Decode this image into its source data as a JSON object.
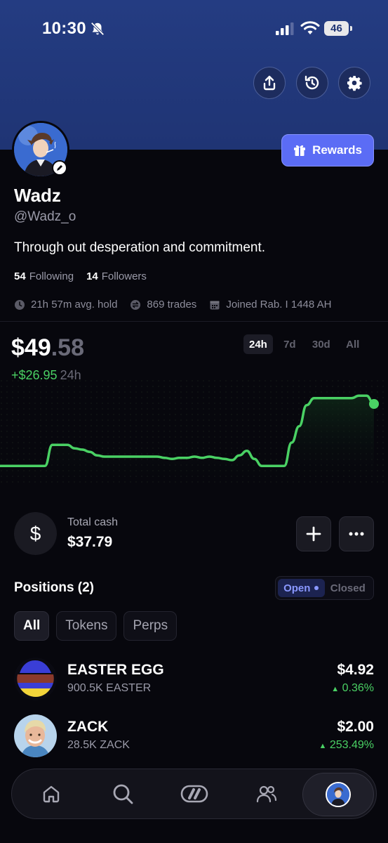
{
  "status_bar": {
    "time": "10:30",
    "battery": "46"
  },
  "header": {
    "share_icon": "share-icon",
    "history_icon": "history-icon",
    "settings_icon": "gear-icon",
    "rewards_label": "Rewards"
  },
  "profile": {
    "name": "Wadz",
    "handle": "@Wadz_o",
    "bio": "Through out desperation and commitment.",
    "following_count": "54",
    "following_label": "Following",
    "followers_count": "14",
    "followers_label": "Followers",
    "avg_hold": "21h 57m avg. hold",
    "trades": "869 trades",
    "joined": "Joined Rab. I 1448 AH"
  },
  "portfolio": {
    "balance_dollars": "$49",
    "balance_cents": ".58",
    "change_value": "+$26.95",
    "change_period": "24h",
    "ranges": [
      "24h",
      "7d",
      "30d",
      "All"
    ],
    "active_range": "24h",
    "accent_color": "#4ad164"
  },
  "chart_data": {
    "type": "line",
    "title": "",
    "xlabel": "",
    "ylabel": "",
    "x": [
      0,
      1,
      2,
      3,
      4,
      5,
      6,
      7,
      8,
      9,
      10,
      11,
      12,
      13,
      14,
      15,
      16,
      17,
      18,
      19,
      20,
      21,
      22,
      23,
      24,
      25,
      26,
      27,
      28,
      29,
      30,
      31,
      32,
      33,
      34,
      35,
      36,
      37,
      38,
      39,
      40,
      41,
      42,
      43,
      44,
      45,
      46,
      47,
      48,
      49,
      50
    ],
    "values": [
      22.6,
      22.6,
      22.6,
      22.6,
      22.6,
      22.6,
      22.6,
      24.4,
      24.4,
      24.4,
      24.1,
      24.0,
      23.8,
      23.5,
      23.4,
      23.4,
      23.4,
      23.4,
      23.4,
      23.4,
      23.4,
      23.4,
      23.3,
      23.2,
      23.3,
      23.3,
      23.4,
      23.3,
      23.4,
      23.3,
      23.2,
      23.1,
      23.5,
      23.9,
      23.2,
      22.6,
      22.6,
      22.6,
      22.6,
      24.6,
      26.0,
      27.8,
      28.4,
      28.4,
      28.4,
      28.4,
      28.4,
      28.4,
      28.6,
      28.6,
      27.9
    ],
    "ylim": [
      21.0,
      30.0
    ],
    "grid": false,
    "legend": "none"
  },
  "cash": {
    "icon": "dollar-icon",
    "label": "Total cash",
    "value": "$37.79"
  },
  "positions": {
    "title": "Positions (2)",
    "toggle_open": "Open",
    "toggle_closed": "Closed",
    "filters": [
      "All",
      "Tokens",
      "Perps"
    ],
    "items": [
      {
        "name": "EASTER EGG",
        "amount": "900.5K EASTER",
        "value": "$4.92",
        "change": "0.36%"
      },
      {
        "name": "ZACK",
        "amount": "28.5K ZACK",
        "value": "$2.00",
        "change": "253.49%"
      }
    ]
  },
  "tab_bar": {
    "items": [
      "home-icon",
      "search-icon",
      "trade-icon",
      "people-icon",
      "profile-avatar"
    ]
  }
}
